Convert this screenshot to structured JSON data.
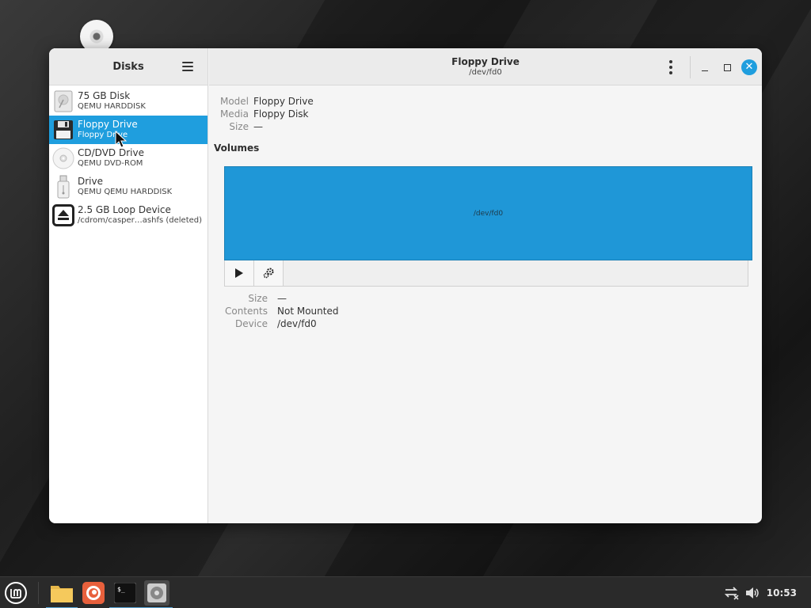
{
  "sidebar": {
    "title": "Disks",
    "disks": [
      {
        "name": "75 GB Disk",
        "sub": "QEMU HARDDISK",
        "icon": "hard-disk-icon"
      },
      {
        "name": "Floppy Drive",
        "sub": "Floppy Drive",
        "icon": "floppy-icon",
        "selected": true
      },
      {
        "name": "CD/DVD Drive",
        "sub": "QEMU DVD-ROM",
        "icon": "optical-drive-icon"
      },
      {
        "name": "Drive",
        "sub": "QEMU QEMU HARDDISK",
        "icon": "usb-drive-icon"
      },
      {
        "name": "2.5 GB Loop Device",
        "sub": "/cdrom/casper…ashfs (deleted)",
        "icon": "eject-icon"
      }
    ]
  },
  "header": {
    "title": "Floppy Drive",
    "subtitle": "/dev/fd0"
  },
  "drive_info": {
    "model_label": "Model",
    "model_value": "Floppy Drive",
    "media_label": "Media",
    "media_value": "Floppy Disk",
    "size_label": "Size",
    "size_value": "—"
  },
  "volumes": {
    "title": "Volumes",
    "bar_label": "/dev/fd0",
    "size_label": "Size",
    "size_value": "—",
    "contents_label": "Contents",
    "contents_value": "Not Mounted",
    "device_label": "Device",
    "device_value": "/dev/fd0"
  },
  "taskbar": {
    "clock": "10:53",
    "apps": [
      "file-manager-icon",
      "firefox-icon",
      "terminal-icon",
      "disks-app-icon"
    ]
  },
  "colors": {
    "accent": "#1f9ede",
    "volume": "#1f97d7"
  }
}
